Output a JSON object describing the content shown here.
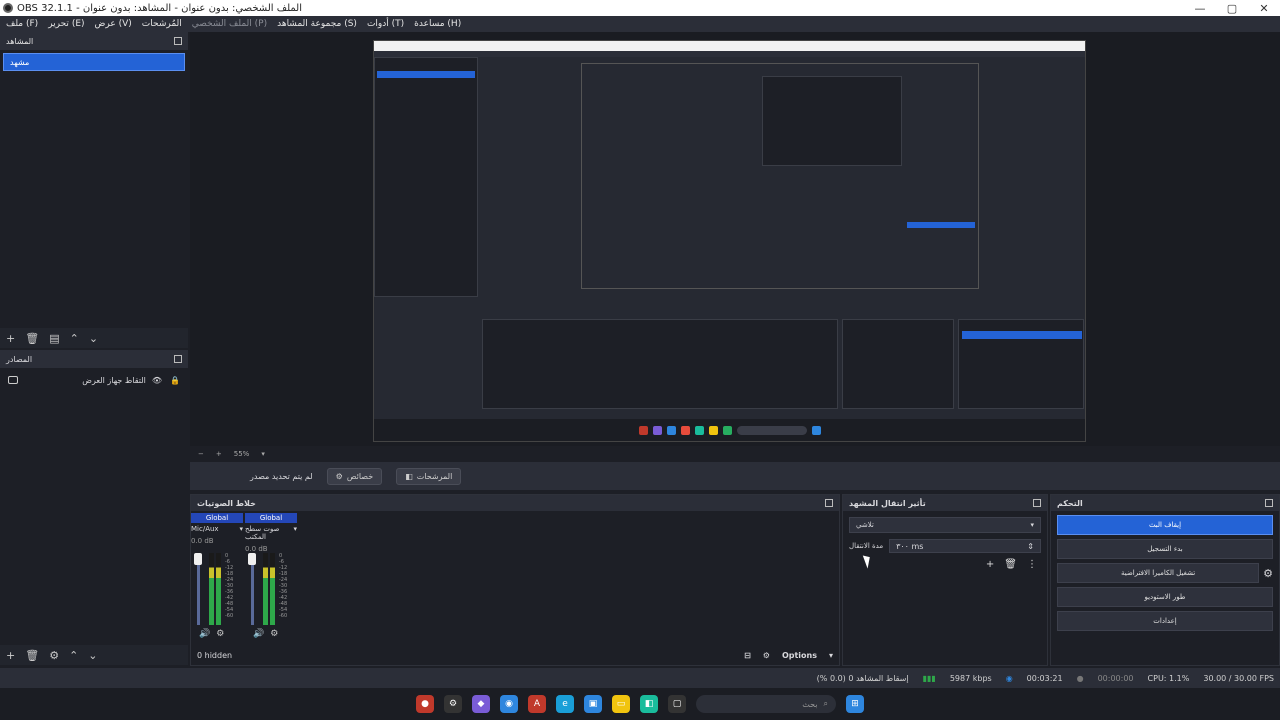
{
  "window": {
    "title": "OBS 32.1.1 - الملف الشخصي: بدون عنوان - المشاهد: بدون عنوان",
    "controls": [
      "—",
      "▢",
      "✕"
    ]
  },
  "menu": {
    "items": [
      "ملف (F)",
      "تحرير (E)",
      "عرض (V)",
      "المُرشحات",
      "الملف الشخصي (P)",
      "مجموعة المشاهد (S)",
      "أدوات (T)",
      "مساعدة (H)"
    ]
  },
  "scenes": {
    "header": "المشاهد",
    "items": [
      "مشهد"
    ]
  },
  "sources": {
    "header": "المصادر",
    "items": [
      {
        "name": "التقاط جهاز العرض",
        "visible": true,
        "locked": true
      }
    ]
  },
  "preview": {
    "zoom": "55%",
    "no_source": "لم يتم تحديد مصدر",
    "properties": "خصائص",
    "filters": "المرشحات"
  },
  "mixer": {
    "header": "خلاط الصوتيات",
    "channels": [
      {
        "tag": "Global",
        "name": "Mic/Aux",
        "db": "0.0 dB"
      },
      {
        "tag": "Global",
        "name": "صوت سطح المكتب",
        "db": "0.0 dB"
      }
    ],
    "scale": [
      "0",
      "-6",
      "-12",
      "-18",
      "-24",
      "-30",
      "-36",
      "-42",
      "-48",
      "-54",
      "-60"
    ],
    "hidden_count": "0 hidden",
    "options": "Options"
  },
  "transitions": {
    "header": "تأثير انتقال المشهد",
    "selected": "تلاشي",
    "duration_label": "مدة الانتقال",
    "duration_value": "٣٠٠ ms"
  },
  "controls": {
    "header": "التحكم",
    "stop_stream": "إيقاف البث",
    "start_recording": "بدء التسجيل",
    "start_virtualcam": "تشغيل الكاميرا الافتراضية",
    "studio_mode": "طور الاستوديو",
    "settings": "إعدادات"
  },
  "status": {
    "dropped": "إسقاط المشاهد 0 (0.0 %)",
    "bitrate": "5987 kbps",
    "stream_time": "00:03:21",
    "rec_time": "00:00:00",
    "cpu": "CPU: 1.1%",
    "fps": "30.00 / 30.00 FPS"
  },
  "taskbar": {
    "search_placeholder": "بحث"
  },
  "colors": {
    "accent": "#2463d6",
    "panel": "#2b2e38",
    "background": "#1d1f26"
  }
}
